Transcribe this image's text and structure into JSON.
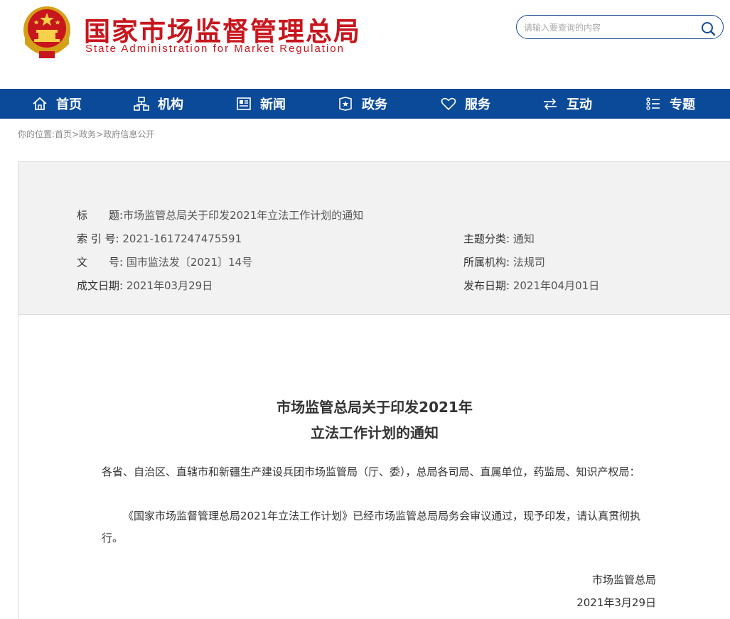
{
  "header": {
    "title_cn": "国家市场监督管理总局",
    "title_en": "State Administration for Market Regulation",
    "search_placeholder": "请输入要查询的内容"
  },
  "nav": {
    "items": [
      {
        "label": "首页",
        "icon": "home-icon"
      },
      {
        "label": "机构",
        "icon": "org-icon"
      },
      {
        "label": "新闻",
        "icon": "news-icon"
      },
      {
        "label": "政务",
        "icon": "government-icon"
      },
      {
        "label": "服务",
        "icon": "heart-icon"
      },
      {
        "label": "互动",
        "icon": "exchange-icon"
      },
      {
        "label": "专题",
        "icon": "list-icon"
      }
    ]
  },
  "breadcrumb": {
    "prefix": "你的位置:",
    "home": "首页",
    "sep": ">",
    "level1": "政务",
    "level2": "政府信息公开"
  },
  "meta": {
    "title_label": "标　　题:",
    "title_value": "市场监管总局关于印发2021年立法工作计划的通知",
    "index_label": "索 引 号:",
    "index_value": "2021-1617247475591",
    "doc_label": "文　　号:",
    "doc_value": "国市监法发〔2021〕14号",
    "date_label": "成文日期:",
    "date_value": "2021年03月29日",
    "topic_label": "主题分类:",
    "topic_value": "通知",
    "org_label": "所属机构:",
    "org_value": "法规司",
    "publish_label": "发布日期:",
    "publish_value": "2021年04月01日"
  },
  "article": {
    "title_line1": "市场监管总局关于印发2021年",
    "title_line2": "立法工作计划的通知",
    "para1": "各省、自治区、直辖市和新疆生产建设兵团市场监管局（厅、委），总局各司局、直属单位，药监局、知识产权局：",
    "para2": "《国家市场监督管理总局2021年立法工作计划》已经市场监管总局局务会审议通过，现予印发，请认真贯彻执行。",
    "signature": "市场监管总局",
    "sign_date": "2021年3月29日"
  },
  "colors": {
    "brand_red": "#c8161d",
    "nav_blue": "#0a4a99"
  }
}
